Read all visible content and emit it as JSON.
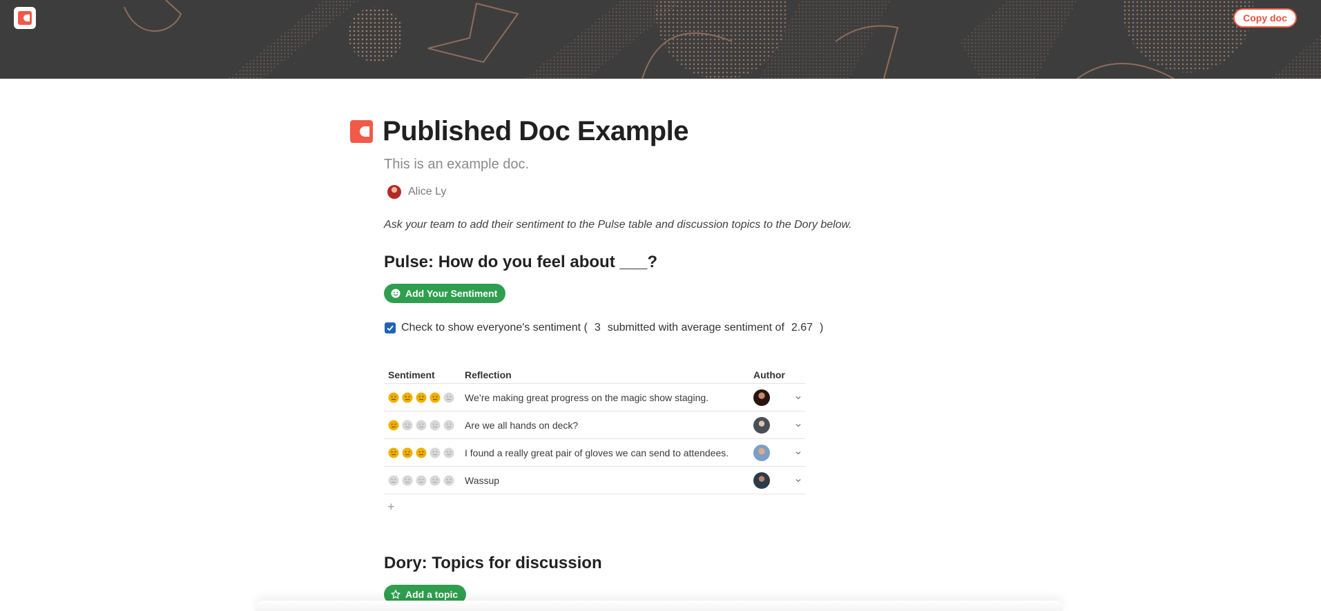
{
  "header": {
    "logo_icon": "coda-logo-icon",
    "copy_label": "Copy doc",
    "accent": "#f15a47",
    "banner_color": "#3e3d3e"
  },
  "doc": {
    "icon": "coda-doc-icon",
    "title": "Published Doc Example",
    "subtitle": "This is an example doc.",
    "author": "Alice Ly",
    "intro": "Ask your team to add their sentiment to the Pulse table and discussion topics to the Dory below."
  },
  "pulse": {
    "heading": "Pulse: How do you feel about ___?",
    "button_label": "Add Your Sentiment",
    "button_icon": "smiley-icon",
    "button_color": "#2f9e4f",
    "checkbox_checked": true,
    "check_text_1": "Check to show everyone's sentiment (",
    "submitted_count": "3",
    "check_text_2": "submitted with average sentiment of",
    "average": "2.67",
    "check_text_3": ")"
  },
  "table": {
    "columns": {
      "sentiment": "Sentiment",
      "reflection": "Reflection",
      "author": "Author"
    },
    "rows": [
      {
        "sentiment": 4,
        "reflection": "We’re making great progress on the magic show staging."
      },
      {
        "sentiment": 1,
        "reflection": "Are we all hands on deck?"
      },
      {
        "sentiment": 3,
        "reflection": "I found a really great pair of gloves we can send to attendees."
      },
      {
        "sentiment": 0,
        "reflection": "Wassup"
      }
    ],
    "max_sentiment": 5,
    "add_row_icon": "plus-icon",
    "filled_color": "#f0b000",
    "empty_color": "#d8d8d8"
  },
  "dory": {
    "heading": "Dory: Topics for discussion",
    "button_label": "Add a topic",
    "button_icon": "star-icon"
  }
}
